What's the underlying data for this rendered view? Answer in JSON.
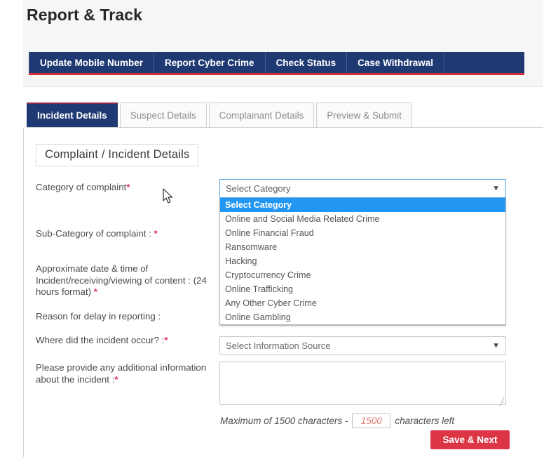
{
  "header": {
    "title": "Report & Track"
  },
  "navbar": {
    "items": [
      {
        "label": "Update Mobile Number"
      },
      {
        "label": "Report Cyber Crime"
      },
      {
        "label": "Check Status"
      },
      {
        "label": "Case Withdrawal"
      }
    ]
  },
  "tabs": [
    {
      "label": "Incident Details",
      "active": true
    },
    {
      "label": "Suspect Details",
      "active": false
    },
    {
      "label": "Complainant Details",
      "active": false
    },
    {
      "label": "Preview & Submit",
      "active": false
    }
  ],
  "form": {
    "section_heading": "Complaint / Incident Details",
    "labels": {
      "category": "Category of complaint",
      "category_required": "*",
      "subcategory": "Sub-Category of complaint : ",
      "subcategory_required": "*",
      "datetime": "Approximate date & time of Incident/receiving/viewing of content : (24 hours format) ",
      "datetime_required": "*",
      "reason_delay": "Reason for delay in reporting :",
      "where_occur": "Where did the incident occur? :",
      "where_occur_required": "*",
      "additional_info": "Please provide any additional information about the incident :",
      "additional_info_required": "*"
    },
    "category_select": {
      "value": "Select Category",
      "arrow_icon": "chevron-down-icon",
      "expanded": true,
      "options": [
        "Select Category",
        "Online and Social Media Related Crime",
        "Online Financial Fraud",
        "Ransomware",
        "Hacking",
        "Cryptocurrency Crime",
        "Online Trafficking",
        "Any Other Cyber Crime",
        "Online Gambling"
      ],
      "selected_option": "Select Category"
    },
    "information_source_select": {
      "value": "Select Information Source",
      "arrow_icon": "chevron-down-icon"
    },
    "additional_info_textarea": {
      "value": "",
      "placeholder": ""
    },
    "counter": {
      "prefix": "Maximum of 1500 characters -",
      "remaining": "1500",
      "suffix": "characters left"
    },
    "save_button": "Save & Next"
  },
  "colors": {
    "navy": "#1f3a72",
    "red_accent": "#cf2d3a",
    "button_red": "#dc3545",
    "highlight_blue": "#2196f3",
    "required_pink": "#e0336b"
  }
}
